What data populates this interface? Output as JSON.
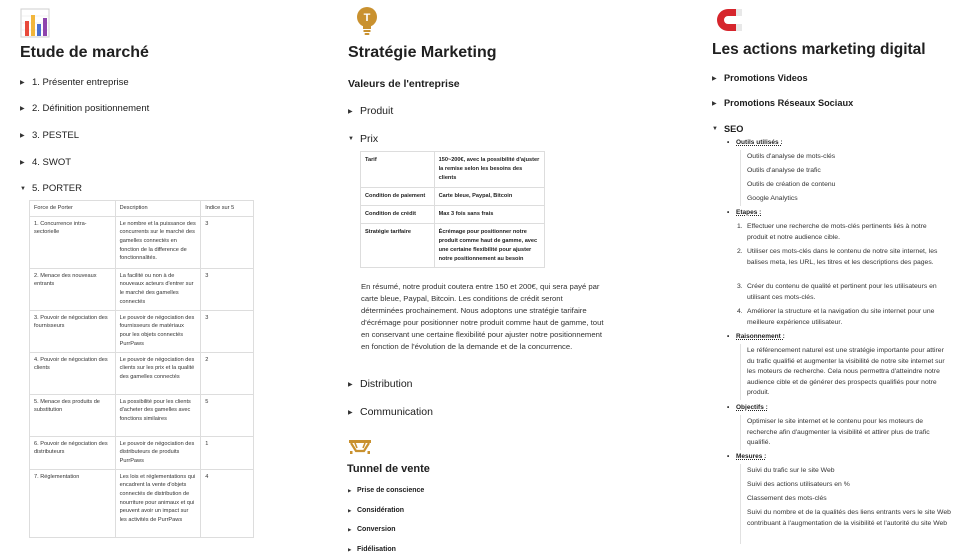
{
  "col1": {
    "title": "Etude de marché",
    "items": [
      "1. Présenter entreprise",
      "2. Définition positionnement",
      "3. PESTEL",
      "4. SWOT",
      "5. PORTER"
    ],
    "table": {
      "headers": [
        "Force de Porter",
        "Description",
        "Indice sur 5"
      ],
      "rows": [
        [
          "1. Concurrence intra-sectorielle",
          "Le nombre et la puissance des concurrents sur le marché des gamelles connectés en fonction de la difference de fonctionnalités.",
          "3"
        ],
        [
          "2. Menace des nouveaux entrants",
          "La facilité ou non à de nouveaux acteurs d'entrer sur le marché des gamelles connectés",
          "3"
        ],
        [
          "3. Pouvoir de négociation des fournisseurs",
          "Le pouvoir de négociation des fournisseurs de matériaux pour les objets connectés PurrPaws",
          "3"
        ],
        [
          "4. Pouvoir de négociation des clients",
          "Le pouvoir de négociation des clients sur les prix et la qualité des gamelles connectés",
          "2"
        ],
        [
          "5. Menace des produits de substitution",
          "La possibilité pour les clients d'acheter des gamelles avec fonctions similaires",
          "5"
        ],
        [
          "6. Pouvoir de négociation des distributeurs",
          "Le pouvoir de négociation des distributeurs de produits PurrPaws",
          "1"
        ],
        [
          "7. Réglementation",
          "Les lois et réglementations qui encadrent la vente d'objets connectés de distribution de nourriture pour animaux et qui peuvent avoir un impact sur les activités de PurrPaws",
          "4"
        ]
      ]
    }
  },
  "col2": {
    "title": "Stratégie Marketing",
    "values_heading": "Valeurs de l'entreprise",
    "produit": "Produit",
    "prix": "Prix",
    "prix_table": [
      [
        "Tarif",
        "150~200€, avec la possibilité d'ajuster la remise selon les besoins des clients"
      ],
      [
        "Condition de paiement",
        "Carte bleue, Paypal, Bitcoin"
      ],
      [
        "Condition de crédit",
        "Max 3 fois sans frais"
      ],
      [
        "Stratégie tarifaire",
        "Écrémage pour positionner notre produit comme haut de gamme, avec une certaine flexibilité pour ajuster notre positionnement au besoin"
      ]
    ],
    "summary": "En résumé, notre produit coutera entre 150 et 200€, qui sera payé par carte bleue, Paypal, Bitcoin. Les conditions de crédit seront déterminées prochainement. Nous adoptons une stratégie tarifaire d'écrémage pour positionner notre produit comme haut de gamme, tout en conservant une certaine flexibilité pour ajuster notre positionnement en fonction de l'évolution de la demande et de la concurrence.",
    "distribution": "Distribution",
    "communication": "Communication",
    "tunnel_title": "Tunnel de vente",
    "tunnel_items": [
      "Prise de conscience",
      "Considération",
      "Conversion",
      "Fidélisation"
    ]
  },
  "col3": {
    "title": "Les actions marketing digital",
    "promo_videos": "Promotions Videos",
    "promo_social": "Promotions Réseaux Sociaux",
    "seo": "SEO",
    "outils_label": "Outils utilisés :",
    "outils": [
      "Outils d'analyse de mots-clés",
      "Outils d'analyse de trafic",
      "Outils de création de contenu",
      "Google Analytics"
    ],
    "etapes_label": "Etapes :",
    "etapes": [
      "Effectuer une recherche de mots-clés pertinents liés à notre produit et notre audience cible.",
      "Utiliser ces mots-clés dans le contenu de notre site internet, les balises meta, les URL, les titres et les descriptions des pages.",
      "Créer du contenu de qualité et pertinent pour les utilisateurs en utilisant ces mots-clés.",
      "Améliorer la structure et la navigation du site internet pour une meilleure expérience utilisateur."
    ],
    "raisonnement_label": "Raisonnement :",
    "raisonnement": "Le référencement naturel est une stratégie importante pour attirer du trafic qualifié et augmenter la visibilité de notre site internet sur les moteurs de recherche. Cela nous permettra d'atteindre notre audience cible et de générer des prospects qualifiés pour notre produit.",
    "objectifs_label": "Objectifs :",
    "objectifs": "Optimiser le site internet et le contenu pour les moteurs de recherche afin d'augmenter la visibilité et attirer plus de trafic qualifié.",
    "mesures_label": "Mesures :",
    "mesures": [
      "Suivi du trafic sur le site Web",
      "Suivi des actions utilisateurs en %",
      "Classement des mots-clés",
      "Suivi du nombre et de la qualités des liens entrants vers le site Web contribuant à l'augmentation de la visibilité et l'autorité du site Web"
    ]
  },
  "colors": {
    "accent_orange": "#c9912f",
    "magnet_red": "#d6252c",
    "chart_blue": "#4a6fd1"
  },
  "icons": [
    "bar-chart-icon",
    "lightbulb-icon",
    "magnet-icon",
    "funnel-icon"
  ]
}
